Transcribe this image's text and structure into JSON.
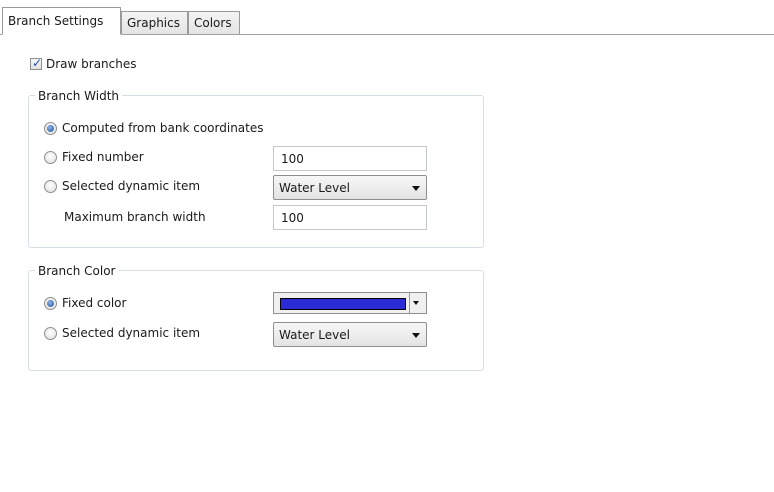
{
  "tabs": [
    {
      "label": "Branch Settings",
      "active": true
    },
    {
      "label": "Graphics",
      "active": false
    },
    {
      "label": "Colors",
      "active": false
    }
  ],
  "draw_branches": {
    "label": "Draw branches",
    "checked": true
  },
  "branch_width": {
    "title": "Branch Width",
    "options": [
      {
        "label": "Computed from bank coordinates",
        "selected": true
      },
      {
        "label": "Fixed number",
        "selected": false
      },
      {
        "label": "Selected dynamic item",
        "selected": false
      }
    ],
    "fixed_number_value": "100",
    "dynamic_item_value": "Water Level",
    "max_width_label": "Maximum branch width",
    "max_width_value": "100"
  },
  "branch_color": {
    "title": "Branch Color",
    "options": [
      {
        "label": "Fixed color",
        "selected": true
      },
      {
        "label": "Selected dynamic item",
        "selected": false
      }
    ],
    "fixed_color": "#2b2bd6",
    "dynamic_item_value": "Water Level"
  },
  "colors": {
    "accent": "#1d4f9a",
    "group_border": "#d5dfe5"
  }
}
